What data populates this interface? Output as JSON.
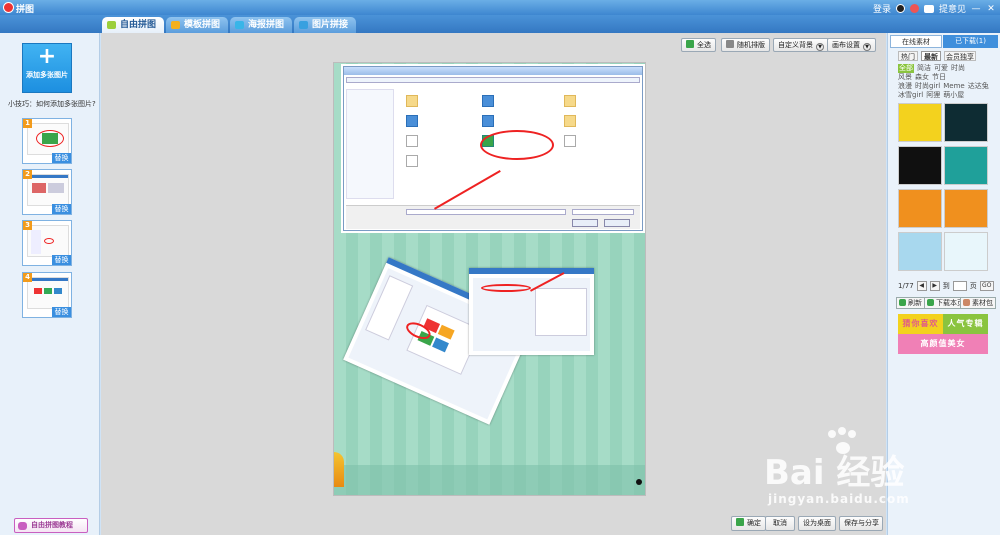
{
  "titlebar": {
    "app_title": "拼图",
    "login": "登录",
    "feedback": "提意见",
    "min": "—",
    "close": "✕"
  },
  "tabs": [
    {
      "label": "自由拼图",
      "color": "#9ccf3c"
    },
    {
      "label": "模板拼图",
      "color": "#f3b01e"
    },
    {
      "label": "海报拼图",
      "color": "#39b5e8"
    },
    {
      "label": "图片拼接",
      "color": "#38a0e0"
    }
  ],
  "left": {
    "add_plus": "+",
    "add_label": "添加多张图片",
    "tip": "小技巧：如何添加多张图片?",
    "thumbs": [
      {
        "num": "1",
        "replace": "替换"
      },
      {
        "num": "2",
        "replace": "替换"
      },
      {
        "num": "3",
        "replace": "替换"
      },
      {
        "num": "4",
        "replace": "替换"
      }
    ],
    "tutorial": "自由拼图教程"
  },
  "toolbar": {
    "select_all": "全选",
    "random": "随机排版",
    "custom_bg": "自定义背景",
    "canvas_settings": "画布设置"
  },
  "bottom": {
    "confirm": "确定",
    "cancel": "取消",
    "set_desktop": "设为桌面",
    "save_share": "保存与分享"
  },
  "right": {
    "tab_online": "在线素材",
    "tab_downloaded": "已下载(1)",
    "subtabs": [
      "热门",
      "最新",
      "会员独享"
    ],
    "categories": [
      "全部",
      "简洁",
      "可爱",
      "时尚",
      "风景",
      "森女",
      "节日",
      "浪漫",
      "时尚girl",
      "Meme",
      "达达兔",
      "冰雪girl",
      "阿狸",
      "萌小屋"
    ],
    "page_info": "1/77",
    "page_prefix": "到",
    "page_suffix": "页",
    "go": "GO",
    "refresh": "刷新",
    "download_page": "下载本页",
    "material_pack": "素材包",
    "promos": [
      "猜你喜欢",
      "人气专辑",
      "高颜值美女"
    ]
  },
  "watermark": {
    "main": "Bai 经验",
    "sub": "jingyan.baidu.com"
  }
}
